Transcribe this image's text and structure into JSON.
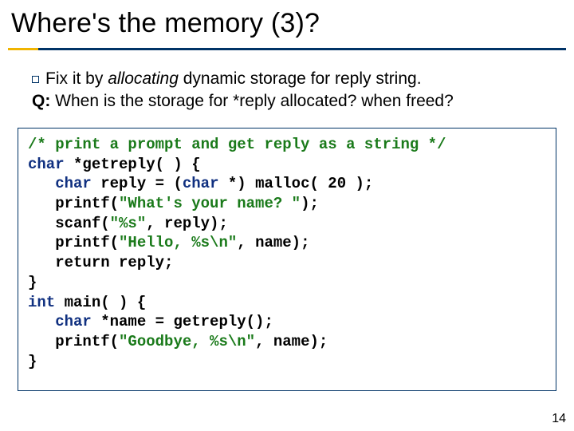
{
  "title": "Where's the memory (3)?",
  "bullet": {
    "pre": "Fix it by ",
    "italic": "allocating",
    "post": " dynamic storage for reply string."
  },
  "question": {
    "label": "Q:",
    "text": " When is the storage for *reply allocated? when freed?"
  },
  "code": {
    "l1_comment": "/* print a prompt and get reply as a string */",
    "l2_a": "char",
    "l2_b": " *getreply( ) {",
    "l3_a": "   char",
    "l3_b": " reply = (",
    "l3_c": "char",
    "l3_d": " *) malloc( 20 );",
    "l4_a": "   printf(",
    "l4_s": "\"What's your name? \"",
    "l4_b": ");",
    "l5_a": "   scanf(",
    "l5_s": "\"%s\"",
    "l5_b": ", reply);",
    "l6_a": "   printf(",
    "l6_s": "\"Hello, %s\\n\"",
    "l6_b": ", name);",
    "l7": "   return reply;",
    "l8": "}",
    "l9_a": "int",
    "l9_b": " main( ) {",
    "l10_a": "   char",
    "l10_b": " *name = getreply();",
    "l11_a": "   printf(",
    "l11_s": "\"Goodbye, %s\\n\"",
    "l11_b": ", name);",
    "l12": "}"
  },
  "pagenum": "14"
}
